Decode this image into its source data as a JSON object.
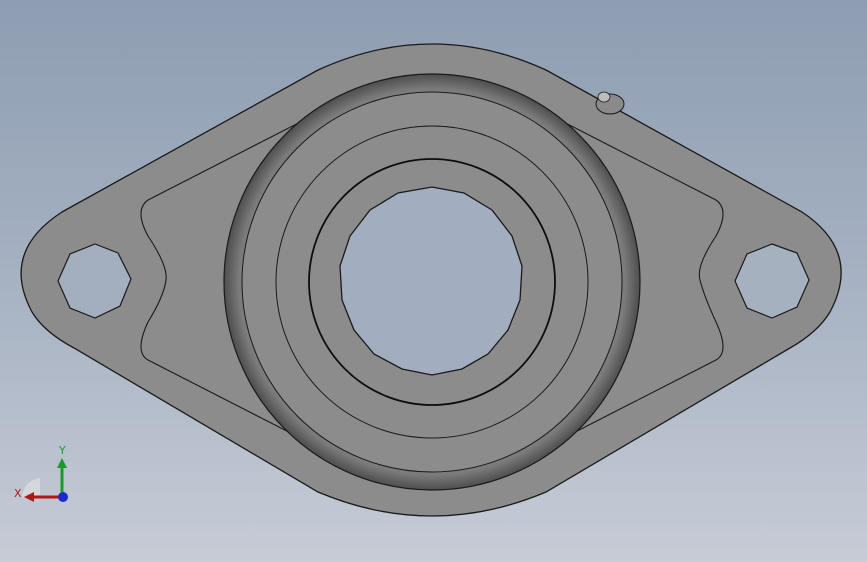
{
  "viewport": {
    "background_top": "#8e9db2",
    "background_bottom": "#c7ccd6"
  },
  "model": {
    "part": "two-bolt-flange-bearing-unit",
    "body_color": "#8c8c8c",
    "edge_color": "#1a1a1a",
    "shade_color": "#5a5a5a"
  },
  "triad": {
    "x_label": "X",
    "y_label": "Y",
    "x_color": "#b01818",
    "y_color": "#1a9a2a",
    "z_color": "#1a2ad0"
  }
}
